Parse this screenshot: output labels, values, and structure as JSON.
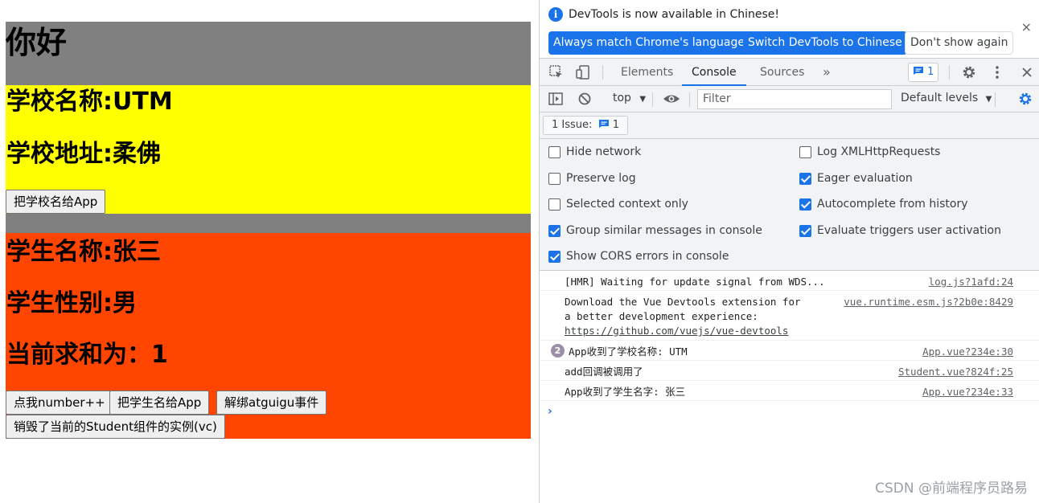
{
  "app": {
    "title": "你好",
    "school": {
      "name": "学校名称:UTM",
      "address": "学校地址:柔佛",
      "send_button": "把学校名给App"
    },
    "student": {
      "name": "学生名称:张三",
      "gender": "学生性别:男",
      "sum": "当前求和为：1",
      "buttons": [
        "点我number++",
        "把学生名给App",
        "解绑atguigu事件",
        "销毁了当前的Student组件的实例(vc)"
      ]
    }
  },
  "devtools": {
    "infobar": {
      "message": "DevTools is now available in Chinese!",
      "buttons": [
        "Always match Chrome's language",
        "Switch DevTools to Chinese",
        "Don't show again"
      ],
      "close": "×"
    },
    "tabs": [
      "Elements",
      "Console",
      "Sources"
    ],
    "active_tab": "Console",
    "more_tabs": "»",
    "issues_badge": "1",
    "toolbar": {
      "context": "top",
      "filter_placeholder": "Filter",
      "levels": "Default levels"
    },
    "issue_button": "1 Issue:",
    "issue_count": "1",
    "settings": [
      {
        "label": "Hide network",
        "checked": false
      },
      {
        "label": "Log XMLHttpRequests",
        "checked": false
      },
      {
        "label": "Preserve log",
        "checked": false
      },
      {
        "label": "Eager evaluation",
        "checked": true
      },
      {
        "label": "Selected context only",
        "checked": false
      },
      {
        "label": "Autocomplete from history",
        "checked": true
      },
      {
        "label": "Group similar messages in console",
        "checked": true
      },
      {
        "label": "Evaluate triggers user activation",
        "checked": true
      },
      {
        "label": "Show CORS errors in console",
        "checked": true
      }
    ],
    "console_messages": [
      {
        "text": "[HMR] Waiting for update signal from WDS...",
        "source": "log.js?1afd:24"
      },
      {
        "text": "Download the Vue Devtools extension for\na better development experience:",
        "link": "https://github.com/vuejs/vue-devtools",
        "source": "vue.runtime.esm.js?2b0e:8429"
      },
      {
        "text": "App收到了学校名称: UTM",
        "count": "2",
        "source": "App.vue?234e:30"
      },
      {
        "text": "add回调被调用了",
        "source": "Student.vue?824f:25"
      },
      {
        "text": "App收到了学生名字: 张三",
        "source": "App.vue?234e:33"
      }
    ],
    "prompt": "›"
  },
  "watermark": "CSDN @前端程序员路易"
}
